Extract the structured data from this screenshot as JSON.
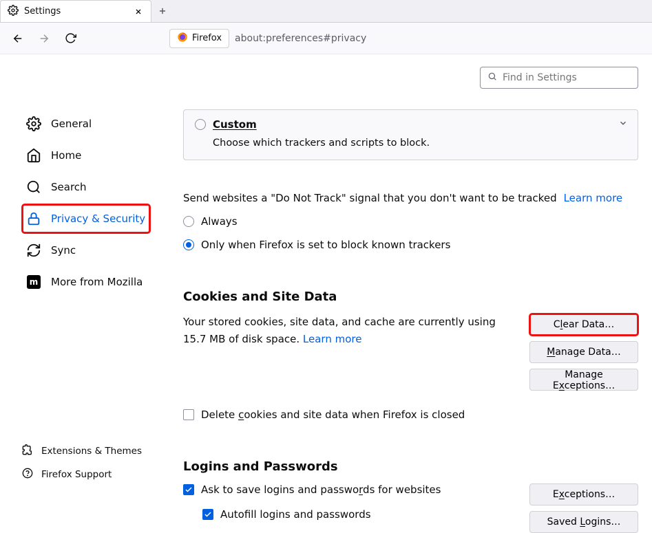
{
  "tab": {
    "title": "Settings"
  },
  "url": {
    "identity": "Firefox",
    "address": "about:preferences#privacy"
  },
  "search": {
    "placeholder": "Find in Settings"
  },
  "sidebar": {
    "items": [
      {
        "label": "General"
      },
      {
        "label": "Home"
      },
      {
        "label": "Search"
      },
      {
        "label": "Privacy & Security"
      },
      {
        "label": "Sync"
      },
      {
        "label": "More from Mozilla"
      }
    ],
    "bottom": [
      {
        "label": "Extensions & Themes"
      },
      {
        "label": "Firefox Support"
      }
    ]
  },
  "main": {
    "custom": {
      "title": "Custom",
      "desc": "Choose which trackers and scripts to block."
    },
    "dnt": {
      "text": "Send websites a \"Do Not Track\" signal that you don't want to be tracked",
      "learn": "Learn more",
      "opt_always": "Always",
      "opt_only": "Only when Firefox is set to block known trackers"
    },
    "cookies": {
      "heading": "Cookies and Site Data",
      "desc_pre": "Your stored cookies, site data, and cache are currently using ",
      "size": "15.7 MB",
      "desc_post": " of disk space.   ",
      "learn": "Learn more",
      "delete_on_close": "Delete cookies and site data when Firefox is closed",
      "btn_clear": "Clear Data…",
      "btn_manage": "Manage Data…",
      "btn_exceptions": "Manage Exceptions…"
    },
    "logins": {
      "heading": "Logins and Passwords",
      "ask_save": "Ask to save logins and passwords for websites",
      "autofill": "Autofill logins and passwords",
      "btn_exceptions": "Exceptions…",
      "btn_saved": "Saved Logins…"
    }
  }
}
